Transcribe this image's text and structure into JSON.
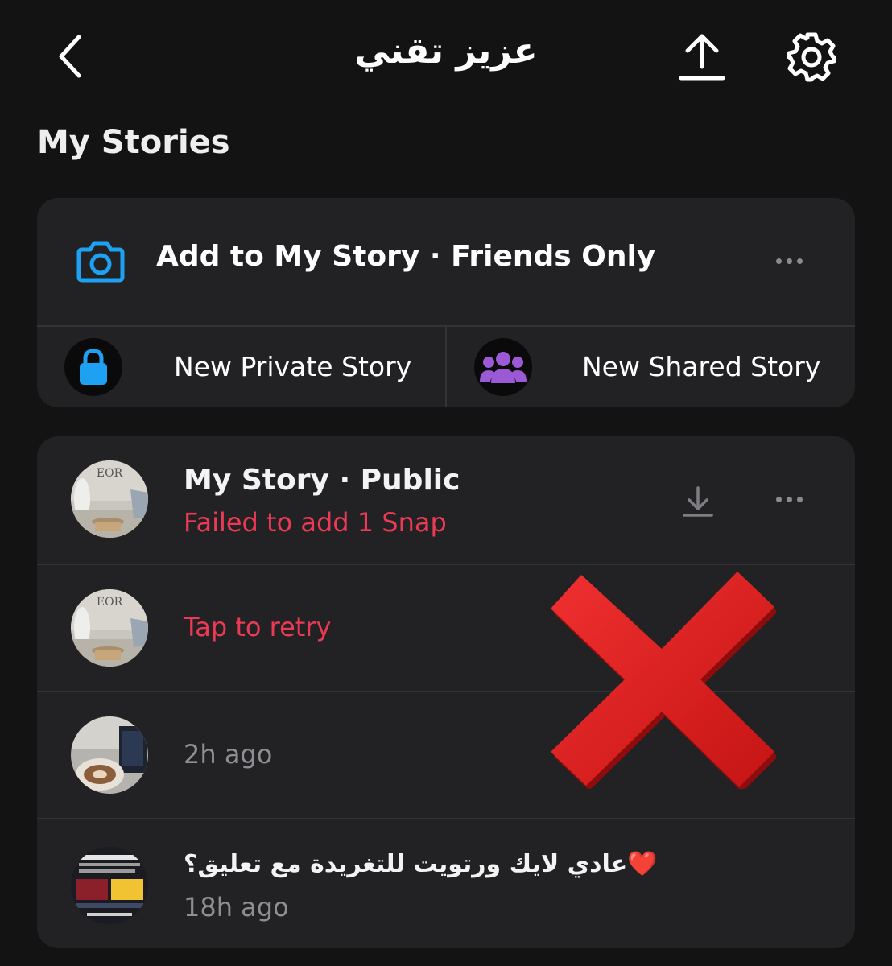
{
  "header": {
    "title": "عزيز تقني",
    "back_icon": "chevron-left-icon",
    "upload_icon": "upload-icon",
    "settings_icon": "gear-icon"
  },
  "section": {
    "title": "My Stories"
  },
  "add_story": {
    "label": "Add to My Story · Friends Only",
    "icon": "camera-icon",
    "accent": "#1ea1f2"
  },
  "quick_actions": {
    "private": {
      "label": "New Private Story",
      "icon": "lock-icon",
      "color": "#1ea1f2"
    },
    "shared": {
      "label": "New Shared Story",
      "icon": "group-icon",
      "color": "#9b59d6"
    }
  },
  "my_story": {
    "title": "My Story · Public",
    "status": "Failed to add 1 Snap",
    "status_color": "#ec3a55"
  },
  "snaps": [
    {
      "text": "Tap to retry",
      "kind": "error"
    },
    {
      "text": "2h ago",
      "kind": "time"
    },
    {
      "caption": "عادي لايك ورتويت للتغريدة مع تعليق؟❤️",
      "time": "18h ago"
    }
  ],
  "overlay": {
    "icon": "red-x-mark-icon",
    "color": "#e01b1b"
  }
}
